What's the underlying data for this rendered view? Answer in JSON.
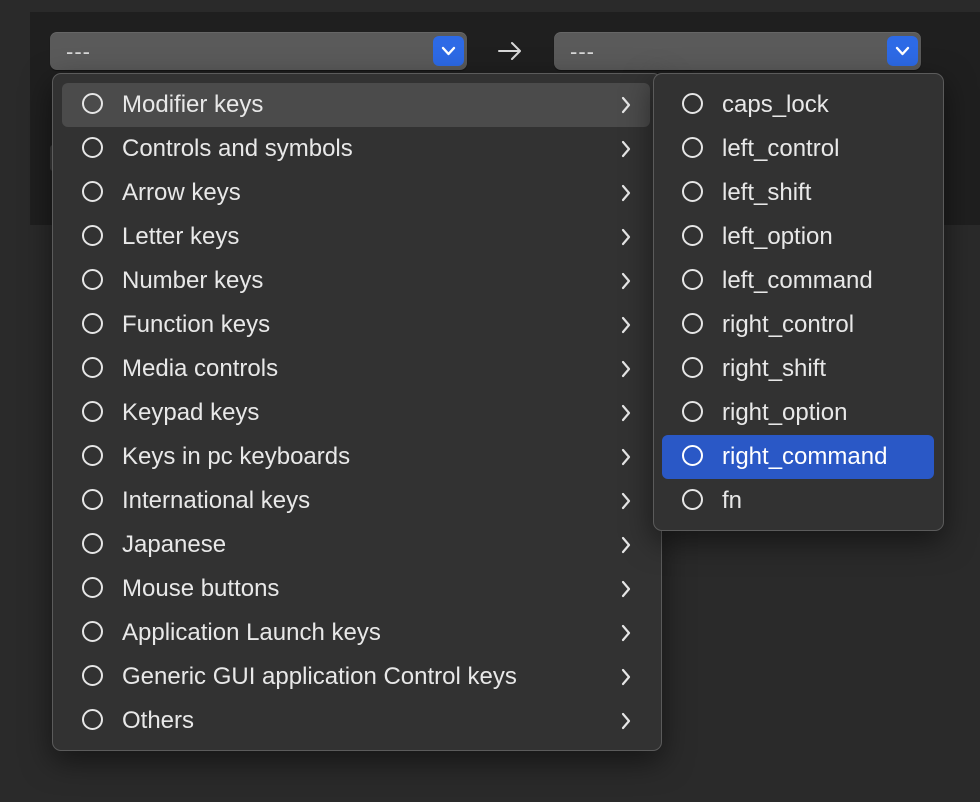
{
  "from_select": {
    "value": "---"
  },
  "to_select": {
    "value": "---"
  },
  "menu": {
    "items": [
      {
        "label": "Modifier keys"
      },
      {
        "label": "Controls and symbols"
      },
      {
        "label": "Arrow keys"
      },
      {
        "label": "Letter keys"
      },
      {
        "label": "Number keys"
      },
      {
        "label": "Function keys"
      },
      {
        "label": "Media controls"
      },
      {
        "label": "Keypad keys"
      },
      {
        "label": "Keys in pc keyboards"
      },
      {
        "label": "International keys"
      },
      {
        "label": "Japanese"
      },
      {
        "label": "Mouse buttons"
      },
      {
        "label": "Application Launch keys"
      },
      {
        "label": "Generic GUI application Control keys"
      },
      {
        "label": "Others"
      }
    ],
    "hovered_item": "Modifier keys"
  },
  "submenu": {
    "items": [
      {
        "label": "caps_lock"
      },
      {
        "label": "left_control"
      },
      {
        "label": "left_shift"
      },
      {
        "label": "left_option"
      },
      {
        "label": "left_command"
      },
      {
        "label": "right_control"
      },
      {
        "label": "right_shift"
      },
      {
        "label": "right_option"
      },
      {
        "label": "right_command"
      },
      {
        "label": "fn"
      }
    ],
    "highlighted_item": "right_command"
  },
  "icons": {
    "stepper": "chevron-down-icon",
    "mapping_arrow": "arrow-right-icon",
    "submenu_indicator": "chevron-right-icon",
    "item_marker": "radio-icon"
  },
  "colors": {
    "accent": "#2d6ae6",
    "selection": "#2a58c6",
    "menu_bg": "#323232"
  }
}
